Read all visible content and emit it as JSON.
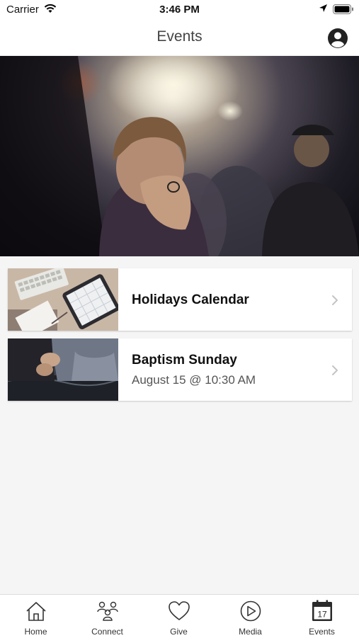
{
  "status": {
    "carrier": "Carrier",
    "time": "3:46 PM"
  },
  "nav": {
    "title": "Events"
  },
  "events": [
    {
      "title": "Holidays Calendar",
      "subtitle": ""
    },
    {
      "title": "Baptism Sunday",
      "subtitle": "August 15 @ 10:30 AM"
    }
  ],
  "tabs": [
    {
      "label": "Home",
      "icon": "home-icon"
    },
    {
      "label": "Connect",
      "icon": "people-icon"
    },
    {
      "label": "Give",
      "icon": "heart-icon"
    },
    {
      "label": "Media",
      "icon": "play-circle-icon"
    },
    {
      "label": "Events",
      "icon": "calendar-icon",
      "active": true,
      "calendar_day": "17"
    }
  ],
  "colors": {
    "background": "#f5f5f5",
    "bar": "#ffffff",
    "chevron": "#c4c4c4"
  }
}
